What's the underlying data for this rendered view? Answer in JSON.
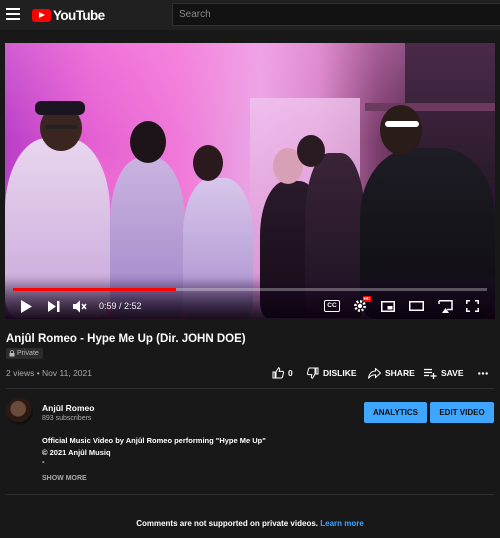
{
  "header": {
    "logo_text": "YouTube",
    "search_placeholder": "Search"
  },
  "player": {
    "time_current": "0:59",
    "time_separator": " / ",
    "time_total": "2:52",
    "progress_fraction": 0.343,
    "cc_label": "CC",
    "hd_badge": "HD"
  },
  "video": {
    "title": "Anjûl Romeo - Hype Me Up (Dir. JOHN DOE)",
    "privacy": "Private",
    "views": "2 views",
    "dot": " • ",
    "date": "Nov 11, 2021",
    "likes": "0",
    "dislike_label": "DISLIKE",
    "share_label": "SHARE",
    "save_label": "SAVE"
  },
  "channel": {
    "name": "Anjûl Romeo",
    "subscribers": "893 subscribers",
    "analytics_label": "ANALYTICS",
    "edit_label": "EDIT VIDEO"
  },
  "description": {
    "line1": "Official Music Video by Anjûl Romeo performing \"Hype Me Up\"",
    "line2": "© 2021 Anjûl Musiq",
    "line3": "-",
    "show_more": "SHOW MORE"
  },
  "comments": {
    "note": "Comments are not supported on private videos.",
    "link": "Learn more"
  },
  "colors": {
    "brand_red": "#ff0000",
    "accent_blue": "#3ea6ff",
    "background": "#181818"
  }
}
